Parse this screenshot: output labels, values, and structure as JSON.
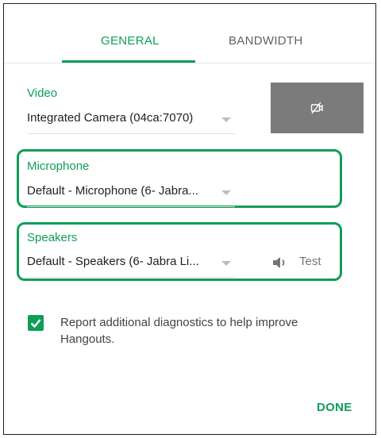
{
  "tabs": [
    {
      "label": "GENERAL",
      "active": true
    },
    {
      "label": "BANDWIDTH",
      "active": false
    }
  ],
  "video": {
    "label": "Video",
    "value": "Integrated Camera (04ca:7070)",
    "preview_icon": "camera-off-icon"
  },
  "microphone": {
    "label": "Microphone",
    "value": "Default - Microphone (6- Jabra..."
  },
  "speakers": {
    "label": "Speakers",
    "value": "Default - Speakers (6- Jabra Li...",
    "test_label": "Test",
    "test_icon": "speaker-icon"
  },
  "diagnostics": {
    "checked": true,
    "label": "Report additional diagnostics to help improve Hangouts."
  },
  "footer": {
    "done_label": "DONE"
  },
  "colors": {
    "accent": "#0f9d58",
    "preview_bg": "#7b7b7b"
  }
}
